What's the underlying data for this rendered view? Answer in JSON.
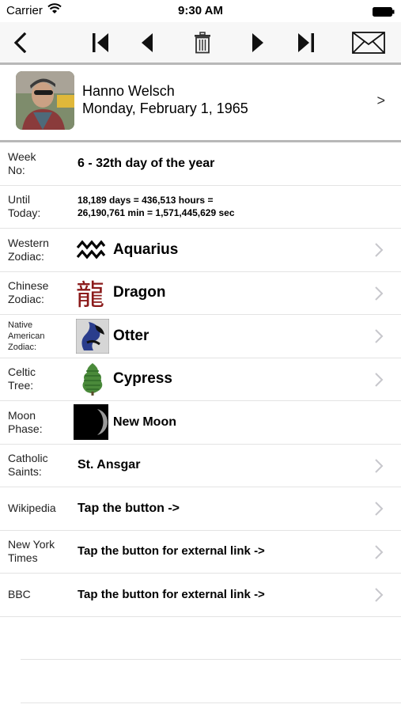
{
  "status": {
    "carrier": "Carrier",
    "time": "9:30 AM"
  },
  "toolbar": {
    "icons": [
      "back-icon",
      "skip-first-icon",
      "previous-icon",
      "trash-icon",
      "next-icon",
      "skip-last-icon",
      "mail-icon"
    ]
  },
  "person": {
    "name": "Hanno Welsch",
    "date": "Monday, February 1, 1965",
    "chevron": ">"
  },
  "rows": {
    "week": {
      "label": "Week No:",
      "value": "6 - 32th day of the year"
    },
    "until": {
      "label": "Until Today:",
      "value_line1": "18,189 days = 436,513 hours =",
      "value_line2": "26,190,761 min = 1,571,445,629 sec"
    },
    "western": {
      "label": "Western Zodiac:",
      "value": "Aquarius",
      "icon": "aquarius-icon"
    },
    "chinese": {
      "label": "Chinese Zodiac:",
      "value": "Dragon",
      "glyph": "龍",
      "icon": "dragon-glyph-icon"
    },
    "native": {
      "label": "Native American Zodiac:",
      "value": "Otter",
      "icon": "otter-icon"
    },
    "celtic": {
      "label": "Celtic Tree:",
      "value": "Cypress",
      "icon": "cypress-tree-icon"
    },
    "moon": {
      "label": "Moon Phase:",
      "value": "New Moon",
      "icon": "moon-phase-icon"
    },
    "saints": {
      "label": "Catholic Saints:",
      "value": "St. Ansgar"
    },
    "wikipedia": {
      "label": "Wikipedia",
      "value": "Tap the button ->"
    },
    "nyt": {
      "label": "New York Times",
      "value": "Tap the button for external link ->"
    },
    "bbc": {
      "label": "BBC",
      "value": "Tap the button for external link ->"
    }
  },
  "colors": {
    "toolbar_bg": "#f7f7f7",
    "separator": "#b8b8b8",
    "row_line": "#e3e3e3",
    "chevron": "#c7c7cc",
    "dragon_red": "#8b1a1a"
  }
}
